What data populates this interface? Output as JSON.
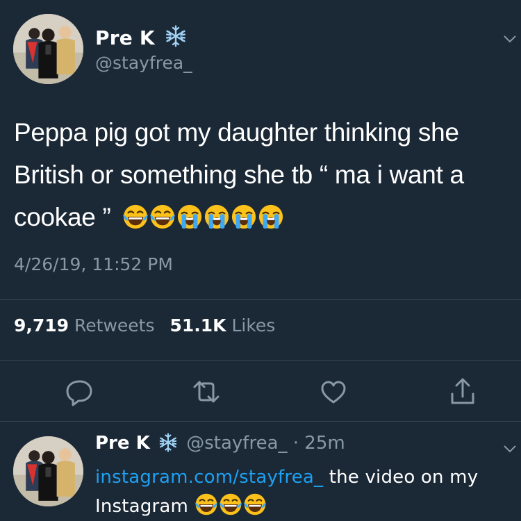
{
  "tweet": {
    "author_name": "Pre K",
    "author_badge_icon": "snowflake-icon",
    "author_handle": "@stayfrea_",
    "text": "Peppa pig got my daughter thinking she British or something she tb “ ma i want a cookae ”",
    "emojis": [
      "joy-emoji",
      "joy-emoji",
      "sob-emoji",
      "sob-emoji",
      "sob-emoji",
      "sob-emoji"
    ],
    "timestamp": "4/26/19, 11:52 PM",
    "retweets_count": "9,719",
    "retweets_label": "Retweets",
    "likes_count": "51.1K",
    "likes_label": "Likes",
    "actions": [
      "reply-icon",
      "retweet-icon",
      "like-icon",
      "share-icon"
    ]
  },
  "reply": {
    "author_name": "Pre K",
    "author_handle": "@stayfrea_",
    "time": "· 25m",
    "link_text": "instagram.com/stayfrea_",
    "text_after_link": " the video on my Instagram",
    "emojis": [
      "joy-emoji",
      "joy-emoji",
      "joy-emoji"
    ]
  },
  "colors": {
    "background": "#1b2836",
    "text": "#ffffff",
    "secondary": "#8899a6",
    "link": "#1da1f2",
    "divider": "#38444d"
  }
}
